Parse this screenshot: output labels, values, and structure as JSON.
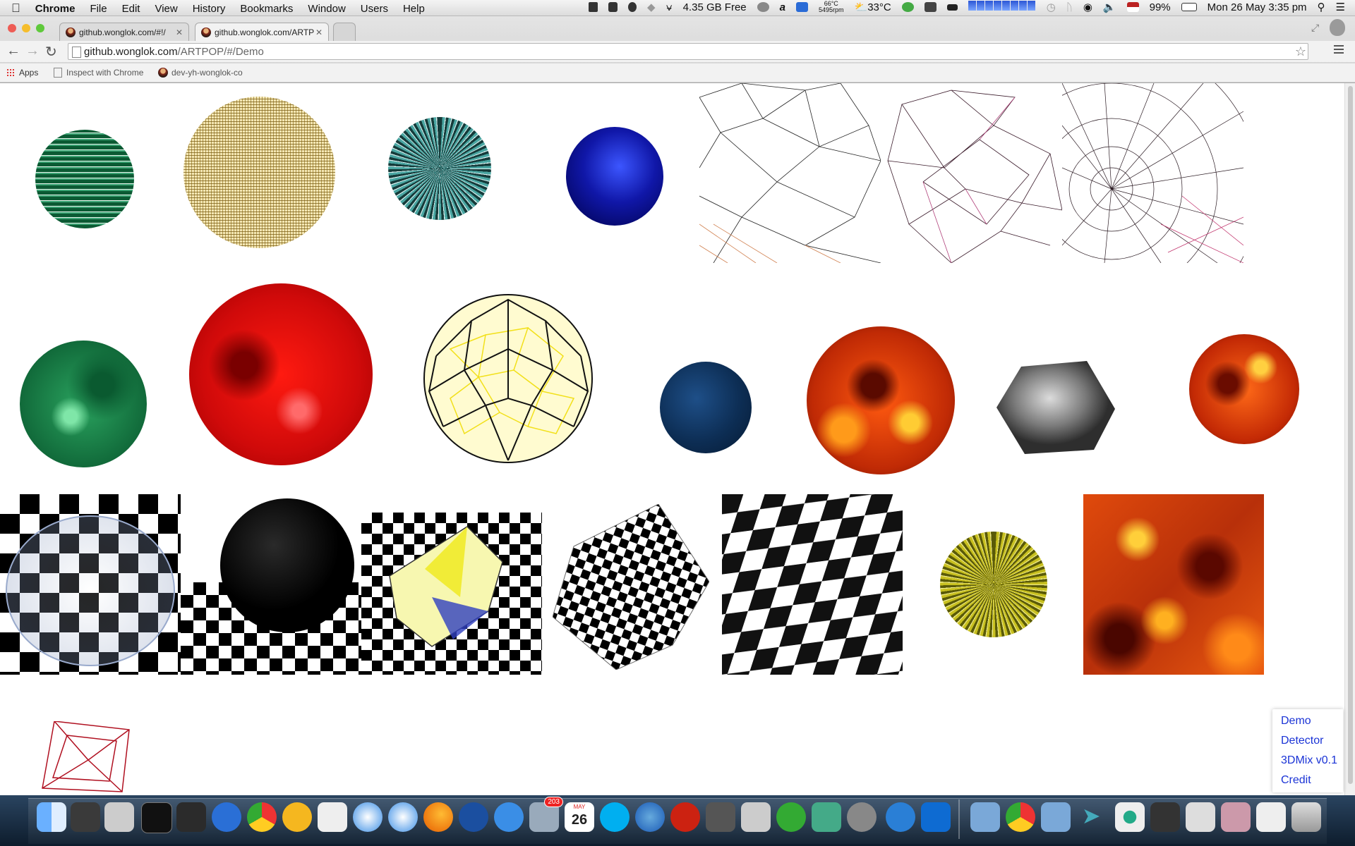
{
  "menubar": {
    "app": "Chrome",
    "items": [
      "File",
      "Edit",
      "View",
      "History",
      "Bookmarks",
      "Window",
      "Users",
      "Help"
    ],
    "disk_free": "4.35 GB Free",
    "fan_temp": "66°C",
    "fan_rpm": "5495rpm",
    "weather": "33°C",
    "battery": "99%",
    "datetime": "Mon 26 May  3:35 pm"
  },
  "browser": {
    "tabs": [
      {
        "title": "github.wonglok.com/#!/"
      },
      {
        "title": "github.wonglok.com/ARTP"
      }
    ],
    "url_host": "github.wonglok.com",
    "url_path": "/ARTPOP/#/Demo",
    "bookmarks": [
      "Apps",
      "Inspect with Chrome",
      "dev-yh-wonglok-co"
    ]
  },
  "sidebar_nav": [
    "Demo",
    "Detector",
    "3DMix v0.1",
    "Credit"
  ],
  "dock": {
    "mail_badge": "203",
    "calendar_month": "MAY",
    "calendar_day": "26"
  },
  "colors": {
    "link": "#1a33d6",
    "lava": "#d8410d",
    "red_sphere": "#e01010",
    "green_sphere": "#1e8c4e",
    "navy_sphere": "#0d2e55",
    "blue_sphere": "#1017a8"
  },
  "icons": [
    "apple-icon",
    "spotlight-icon",
    "wifi-icon",
    "volume-icon",
    "battery-icon",
    "reload-icon",
    "back-icon",
    "forward-icon",
    "star-icon",
    "menu-icon"
  ]
}
